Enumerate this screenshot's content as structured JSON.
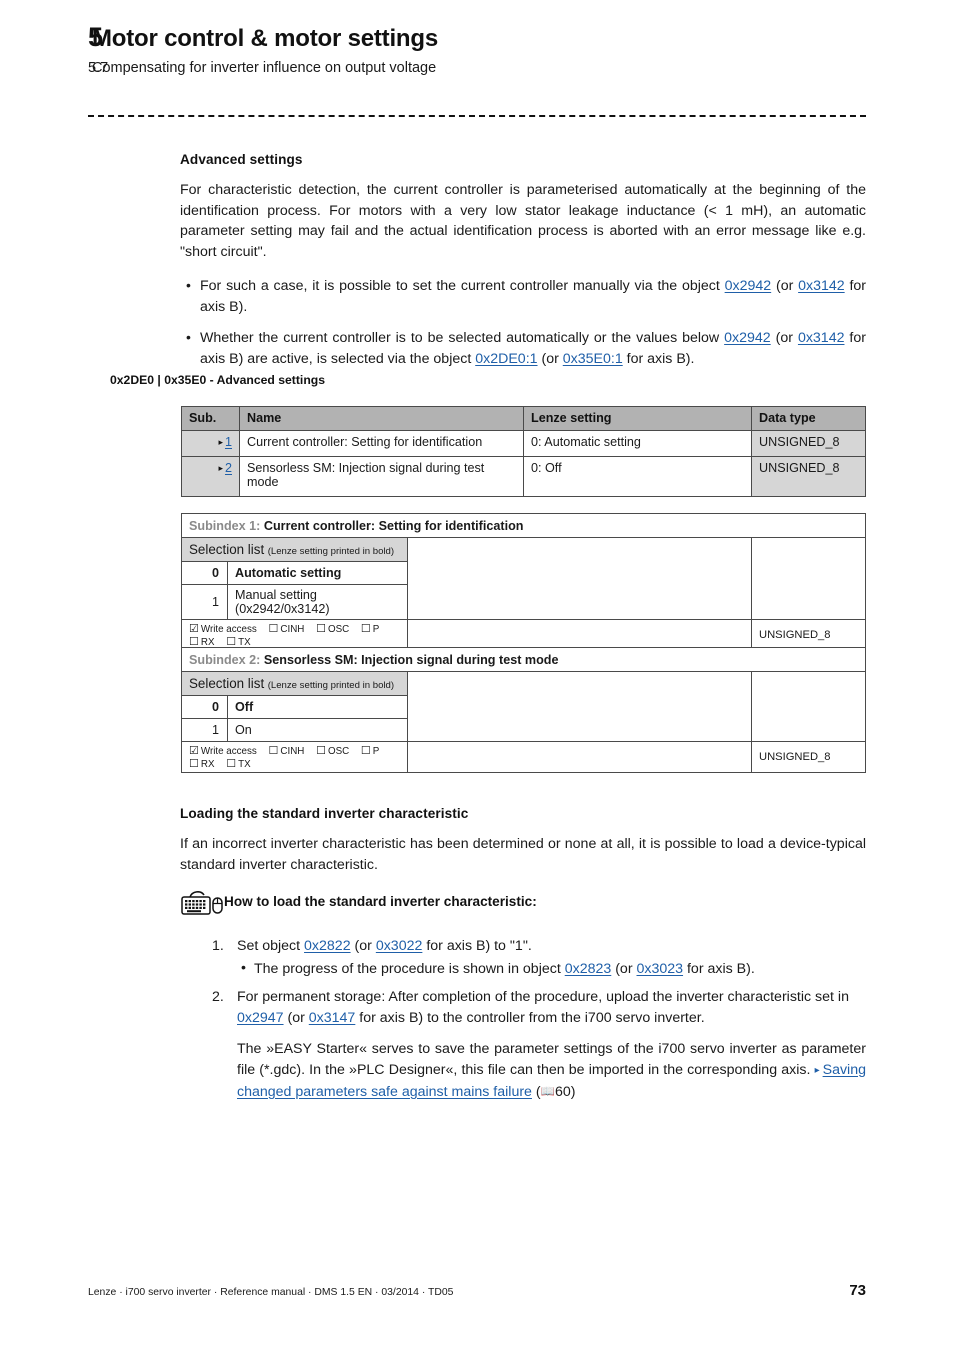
{
  "header": {
    "chapter_number": "5",
    "chapter_title": "Motor control & motor settings",
    "section_number": "5.7",
    "section_title": "Compensating for inverter influence on output voltage"
  },
  "advanced": {
    "heading": "Advanced settings",
    "paragraph": "For characteristic detection, the current controller is parameterised automatically at the beginning of the identification process. For motors with a very low stator leakage inductance (< 1 mH), an automatic parameter setting may fail and the actual identification process is aborted with an error message like e.g. \"short circuit\".",
    "bullets": [
      {
        "p1": "For such a case, it is possible to set the current controller manually via the object ",
        "l1": "0x2942",
        "p2": " (or ",
        "l2": "0x3142",
        "p3": " for axis B)."
      },
      {
        "p1": "Whether the current controller is to be selected automatically or the values below ",
        "l1": "0x2942",
        "p2": " (or ",
        "l2": "0x3142",
        "p3": " for axis B) are active, is selected via the object ",
        "l3": "0x2DE0:1",
        "p4": " (or ",
        "l4": "0x35E0:1",
        "p5": " for axis B)."
      }
    ]
  },
  "object_table": {
    "caption": "0x2DE0 | 0x35E0 - Advanced settings",
    "columns": [
      "Sub.",
      "Name",
      "Lenze setting",
      "Data type"
    ],
    "rows": [
      {
        "sub": "1",
        "name": "Current controller: Setting for identification",
        "lenze_setting": "0: Automatic setting",
        "data_type": "UNSIGNED_8"
      },
      {
        "sub": "2",
        "name": "Sensorless SM: Injection signal during test mode",
        "lenze_setting": "0: Off",
        "data_type": "UNSIGNED_8"
      }
    ]
  },
  "subindex_tables": [
    {
      "label": "Subindex 1:",
      "title": "Current controller: Setting for identification",
      "selection_list_label": "Selection list",
      "selection_list_hint": "(Lenze setting printed in bold)",
      "options": [
        {
          "value": "0",
          "text": "Automatic setting",
          "bold": true
        },
        {
          "value": "1",
          "text": "Manual setting (0x2942/0x3142)",
          "bold": false
        }
      ],
      "access": {
        "write_access": {
          "label": "Write access",
          "checked": true
        },
        "flags": [
          {
            "label": "CINH",
            "checked": false
          },
          {
            "label": "OSC",
            "checked": false
          },
          {
            "label": "P",
            "checked": false
          },
          {
            "label": "RX",
            "checked": false
          },
          {
            "label": "TX",
            "checked": false
          }
        ],
        "data_type": "UNSIGNED_8"
      }
    },
    {
      "label": "Subindex 2:",
      "title": "Sensorless SM: Injection signal during test mode",
      "selection_list_label": "Selection list",
      "selection_list_hint": "(Lenze setting printed in bold)",
      "options": [
        {
          "value": "0",
          "text": "Off",
          "bold": true
        },
        {
          "value": "1",
          "text": "On",
          "bold": false
        }
      ],
      "access": {
        "write_access": {
          "label": "Write access",
          "checked": true
        },
        "flags": [
          {
            "label": "CINH",
            "checked": false
          },
          {
            "label": "OSC",
            "checked": false
          },
          {
            "label": "P",
            "checked": false
          },
          {
            "label": "RX",
            "checked": false
          },
          {
            "label": "TX",
            "checked": false
          }
        ],
        "data_type": "UNSIGNED_8"
      }
    }
  ],
  "loading": {
    "heading": "Loading the standard inverter characteristic",
    "paragraph": "If an incorrect inverter characteristic has been determined or none at all, it is possible to load a device-typical standard inverter characteristic.",
    "howto_title": "How to load the standard inverter characteristic:",
    "step1": {
      "p1": "Set object ",
      "l1": "0x2822",
      "p2": " (or ",
      "l2": "0x3022",
      "p3": " for axis B) to \"1\".",
      "sub": {
        "p1": "The progress of the procedure is shown in object ",
        "l1": "0x2823",
        "p2": " (or ",
        "l2": "0x3023",
        "p3": " for axis B)."
      }
    },
    "step2": {
      "p1": "For permanent storage: After completion of the procedure, upload the inverter characteristic set in ",
      "l1": "0x2947",
      "p2": " (or ",
      "l2": "0x3147",
      "p3": " for axis B) to the controller from the i700 servo inverter."
    },
    "closing": {
      "p1": "The »EASY Starter« serves to save the parameter settings of the i700 servo inverter as parameter file (*.gdc). In the »PLC Designer«, this file can then be imported in the corresponding axis. ",
      "xref": "Saving changed parameters safe against mains failure",
      "page_open": " (",
      "page_number": "60",
      "page_close": ")"
    }
  },
  "footer": {
    "left": "Lenze · i700 servo inverter · Reference manual · DMS 1.5 EN · 03/2014 · TD05",
    "page": "73"
  },
  "colors": {
    "link": "#1f5fa8",
    "table_header": "#b2b2b2",
    "table_shade": "#d6d6d6"
  }
}
